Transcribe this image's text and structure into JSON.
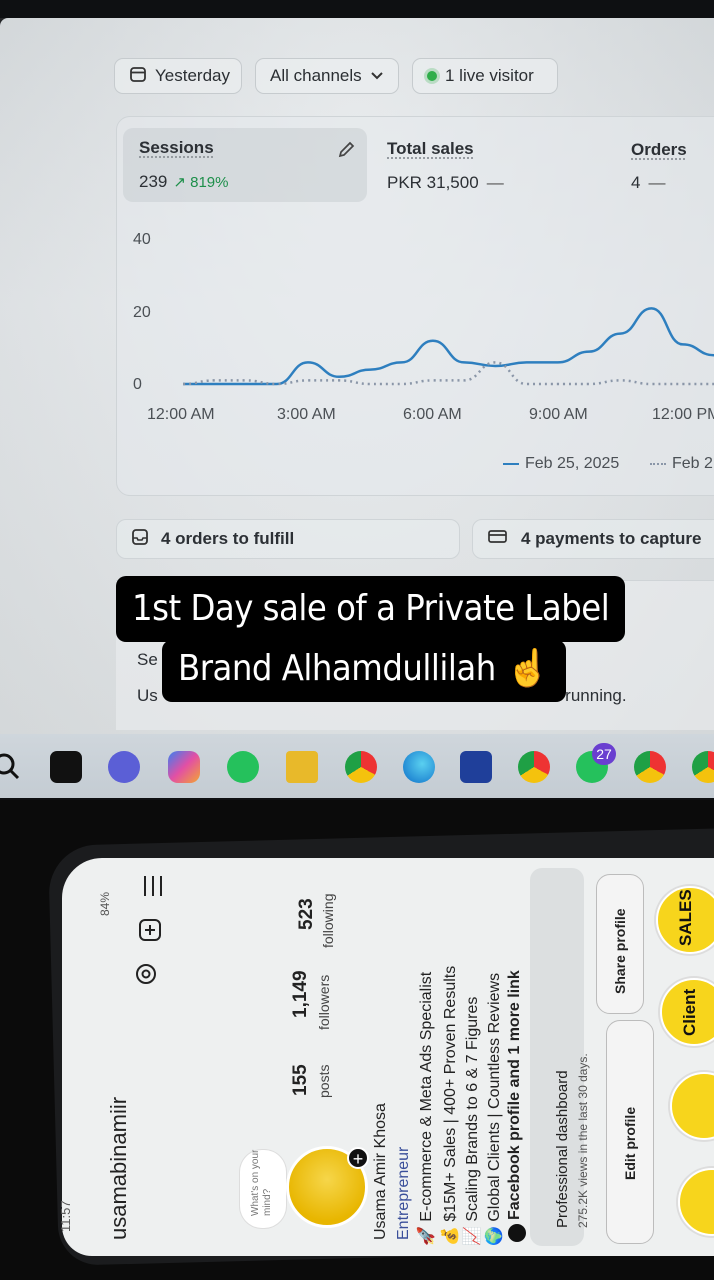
{
  "monitor": {
    "filters": {
      "date": "Yesterday",
      "channels": "All channels",
      "live": "1 live visitor"
    },
    "metrics": [
      {
        "label": "Sessions",
        "value": "239",
        "change": "↗ 819%"
      },
      {
        "label": "Total sales",
        "value": "PKR 31,500",
        "change": "—"
      },
      {
        "label": "Orders",
        "value": "4",
        "change": "—"
      }
    ],
    "chart_data": {
      "type": "line",
      "y_ticks": [
        "40",
        "20",
        "0"
      ],
      "x_ticks": [
        "12:00 AM",
        "3:00 AM",
        "6:00 AM",
        "9:00 AM",
        "12:00 PM"
      ],
      "ylim": [
        0,
        40
      ],
      "x_hours": [
        0,
        1,
        2,
        3,
        4,
        5,
        6,
        7,
        8,
        9,
        10,
        11,
        12,
        13
      ],
      "series": [
        {
          "name": "Feb 25, 2025",
          "style": "solid",
          "color": "#2e7fbf",
          "values": [
            0,
            0,
            0,
            0,
            6,
            2,
            4,
            6,
            12,
            6,
            5,
            6,
            6,
            9,
            14,
            21,
            11,
            8
          ]
        },
        {
          "name": "Feb 2",
          "style": "dotted",
          "color": "#8a96a8",
          "values": [
            0,
            1,
            1,
            0,
            1,
            1,
            0,
            0,
            1,
            1,
            6,
            0,
            0,
            0,
            1,
            0,
            0,
            0
          ]
        }
      ],
      "legend": [
        "Feb 25, 2025",
        "Feb 2"
      ]
    },
    "actions": {
      "orders": "4 orders to fulfill",
      "payments": "4 payments to capture"
    },
    "setup_peek": {
      "line1": "Se",
      "line2_start": "Us",
      "line2_end": "d running."
    },
    "taskbar_badges": {
      "whatsapp": "27"
    }
  },
  "caption": {
    "line1": "1st Day sale of a Private Label",
    "line2": "Brand Alhamdullilah ☝️"
  },
  "phone": {
    "status": {
      "time": "11:57",
      "battery": "84%"
    },
    "username": "usamabinamiir",
    "stats": [
      {
        "value": "155",
        "label": "posts"
      },
      {
        "value": "1,149",
        "label": "followers"
      },
      {
        "value": "523",
        "label": "following"
      }
    ],
    "bubble": "What's on your mind?",
    "name": "Usama Amir Khosa",
    "category": "Entrepreneur",
    "bio": [
      "🚀 E-commerce & Meta Ads Specialist",
      "💰 $15M+ Sales | 400+ Proven Results",
      "📈 Scaling Brands to 6 & 7 Figures",
      "🌍 Global Clients | Countless Reviews",
      "Facebook profile and 1 more link"
    ],
    "dashboard": {
      "title": "Professional dashboard",
      "sub": "275.2K views in the last 30 days."
    },
    "buttons": {
      "edit": "Edit profile",
      "share": "Share profile"
    },
    "highlights": [
      "SALES",
      "Client",
      "",
      ""
    ]
  }
}
